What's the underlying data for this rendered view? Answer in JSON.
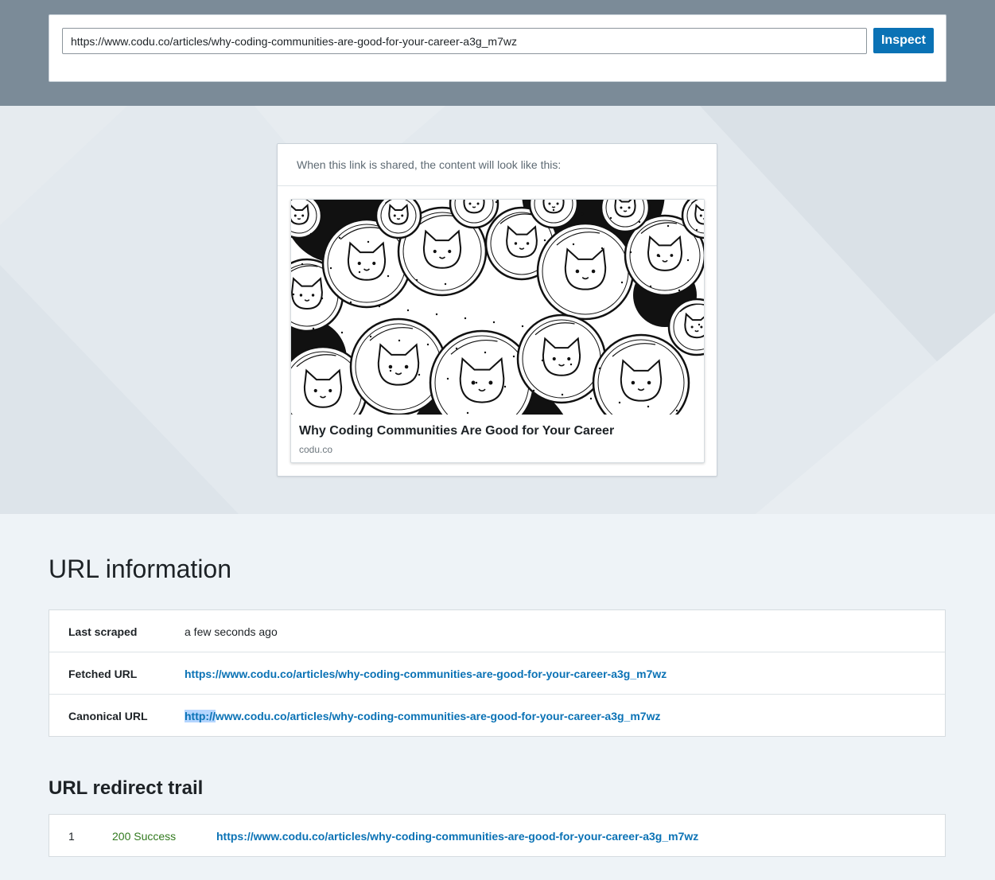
{
  "inspector": {
    "url_value": "https://www.codu.co/articles/why-coding-communities-are-good-for-your-career-a3g_m7wz",
    "inspect_label": "Inspect"
  },
  "preview": {
    "caption": "When this link is shared, the content will look like this:",
    "card_title": "Why Coding Communities Are Good for Your Career",
    "card_domain": "codu.co"
  },
  "url_info": {
    "heading": "URL information",
    "rows": [
      {
        "label": "Last scraped",
        "value": "a few seconds ago"
      },
      {
        "label": "Fetched URL",
        "value": "https://www.codu.co/articles/why-coding-communities-are-good-for-your-career-a3g_m7wz"
      },
      {
        "label": "Canonical URL",
        "value_selected": "http://",
        "value_rest": "www.codu.co/articles/why-coding-communities-are-good-for-your-career-a3g_m7wz"
      }
    ]
  },
  "redirect_trail": {
    "heading": "URL redirect trail",
    "rows": [
      {
        "index": "1",
        "status": "200 Success",
        "url": "https://www.codu.co/articles/why-coding-communities-are-good-for-your-career-a3g_m7wz"
      }
    ]
  },
  "colors": {
    "accent": "#0a72b5",
    "success": "#327a1f",
    "header_band": "#7b8b98"
  }
}
